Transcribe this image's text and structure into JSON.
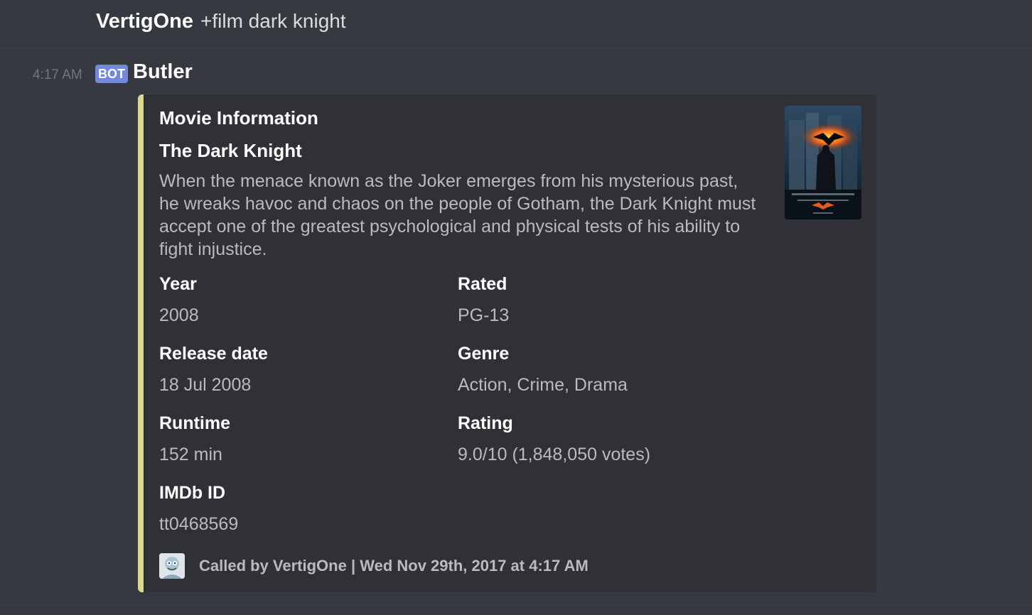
{
  "previous_message": {
    "author": "VertigOne",
    "text": "+film dark knight"
  },
  "bot_message": {
    "timestamp": "4:17 AM",
    "bot_tag": "BOT",
    "author": "Butler",
    "embed": {
      "accent_color": "#dbd78f",
      "author": "Movie Information",
      "title": "The Dark Knight",
      "description": "When the menace known as the Joker emerges from his mysterious past, he wreaks havoc and chaos on the people of Gotham, the Dark Knight must accept one of the greatest psychological and physical tests of his ability to fight injustice.",
      "thumbnail_icon": "movie-poster",
      "fields": [
        {
          "name": "Year",
          "value": "2008"
        },
        {
          "name": "Rated",
          "value": "PG-13"
        },
        {
          "name": "Release date",
          "value": "18 Jul 2008"
        },
        {
          "name": "Genre",
          "value": "Action, Crime, Drama"
        },
        {
          "name": "Runtime",
          "value": "152 min"
        },
        {
          "name": "Rating",
          "value": "9.0/10 (1,848,050 votes)"
        },
        {
          "name": "IMDb ID",
          "value": "tt0468569"
        }
      ],
      "footer": {
        "icon": "user-avatar",
        "text": "Called by VertigOne | Wed Nov 29th, 2017 at 4:17 AM"
      }
    }
  }
}
